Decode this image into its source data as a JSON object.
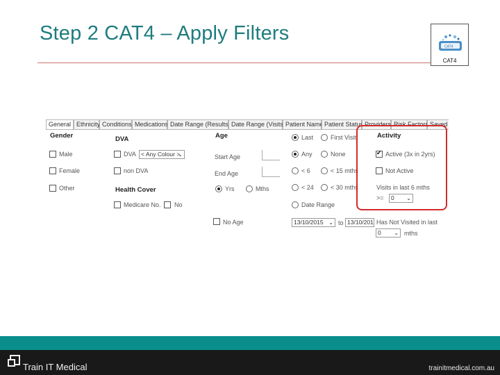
{
  "slide": {
    "title": "Step 2 CAT4 – Apply Filters",
    "logo_label": "CAT4",
    "logo_icon": "cat4-app-icon"
  },
  "tabs": [
    "General",
    "Ethnicity",
    "Conditions",
    "Medications",
    "Date Range (Results)",
    "Date Range (Visits)",
    "Patient Name",
    "Patient Status",
    "Providers",
    "Risk Factors",
    "Saved"
  ],
  "active_tab": "General",
  "gender": {
    "heading": "Gender",
    "options": [
      {
        "label": "Male",
        "checked": false
      },
      {
        "label": "Female",
        "checked": false
      },
      {
        "label": "Other",
        "checked": false
      }
    ]
  },
  "dva": {
    "heading": "DVA",
    "dva_label": "DVA",
    "colour_select": "< Any Colour >",
    "non_dva_label": "non DVA"
  },
  "health_cover": {
    "heading": "Health Cover",
    "medicare_label": "Medicare No.",
    "no_label": "No"
  },
  "age": {
    "heading": "Age",
    "start_age_label": "Start Age",
    "end_age_label": "End Age",
    "yrs_label": "Yrs",
    "mths_label": "Mths",
    "no_age_label": "No Age"
  },
  "visits": {
    "last_label": "Last",
    "first_visit_label": "First Visit",
    "any_label": "Any",
    "none_label": "None",
    "lt6_label": "< 6",
    "lt15_label": "< 15 mths",
    "lt24_label": "< 24",
    "lt30_label": "< 30 mths",
    "date_range_label": "Date Range",
    "date_from": "13/10/2015",
    "to_label": "to",
    "date_to": "13/10/201"
  },
  "activity": {
    "heading": "Activity",
    "active_label": "Active (3x in 2yrs)",
    "active_checked": true,
    "not_active_label": "Not Active",
    "not_active_checked": false,
    "visits_label": "Visits in last 6 mths",
    "gte_label": ">=",
    "visits_value": "0",
    "has_not_visited_label": "Has Not Visited in last",
    "has_not_value": "0",
    "mths_label": "mths",
    "highlight_color": "#d42a2a"
  },
  "footer": {
    "brand": "Train IT Medical",
    "url": "trainitmedical.com.au",
    "teal_color": "#0a8e8c"
  }
}
